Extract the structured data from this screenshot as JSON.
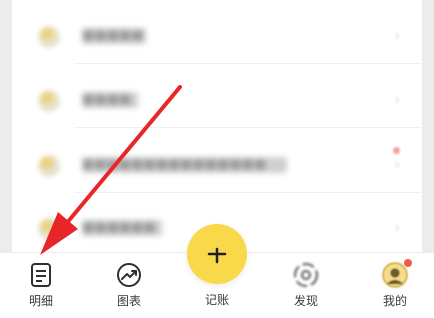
{
  "list": {
    "items": [
      {
        "label": "■■■■■",
        "icon": "note-icon"
      },
      {
        "label": "■■■■",
        "icon": "pencil-icon"
      },
      {
        "label": "■■■■■■■■■■■■■■■",
        "icon": "coin-icon"
      },
      {
        "label": "■■■■■■",
        "icon": "note-icon"
      }
    ]
  },
  "tabbar": {
    "detail_label": "明细",
    "chart_label": "图表",
    "add_label": "记账",
    "add_symbol": "+",
    "discover_label": "发现",
    "mine_label": "我的"
  },
  "colors": {
    "accent": "#f9d84a",
    "annotation_arrow": "#e8262a",
    "badge": "#f05a4a"
  }
}
